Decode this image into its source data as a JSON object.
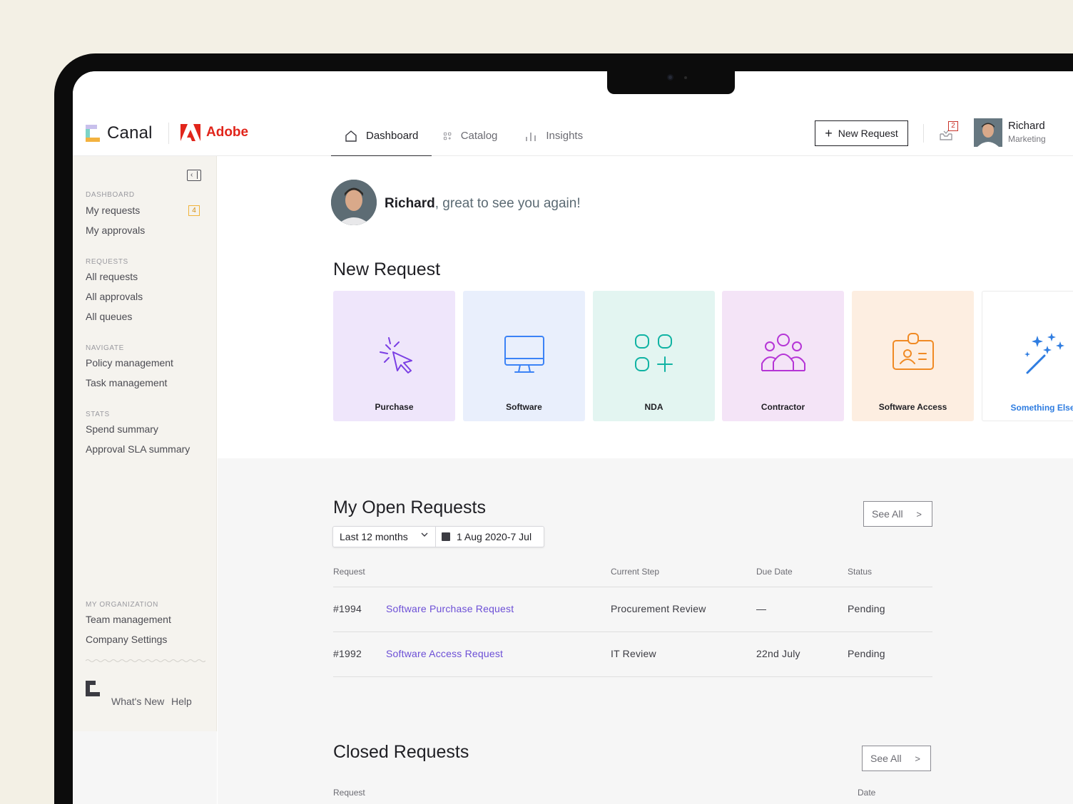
{
  "brand": {
    "app_name": "Canal",
    "partner_name": "Adobe"
  },
  "nav": {
    "items": [
      {
        "label": "Dashboard",
        "icon": "home-icon",
        "active": true
      },
      {
        "label": "Catalog",
        "icon": "grid-icon",
        "active": false
      },
      {
        "label": "Insights",
        "icon": "bar-chart-icon",
        "active": false
      }
    ]
  },
  "header": {
    "new_request_label": "New Request",
    "inbox_count": "2",
    "user": {
      "name": "Richard",
      "role": "Marketing"
    }
  },
  "sidebar": {
    "sections": [
      {
        "title": "DASHBOARD",
        "items": [
          "My requests",
          "My approvals"
        ]
      },
      {
        "title": "REQUESTS",
        "items": [
          "All requests",
          "All approvals",
          "All queues"
        ]
      },
      {
        "title": "NAVIGATE",
        "items": [
          "Policy management",
          "Task management"
        ]
      },
      {
        "title": "STATS",
        "items": [
          "Spend summary",
          "Approval SLA summary"
        ]
      },
      {
        "title": "MY ORGANIZATION",
        "items": [
          "Team management",
          "Company Settings"
        ]
      }
    ],
    "my_requests_badge": "4",
    "footer": {
      "whats_new": "What's New",
      "help": "Help"
    }
  },
  "greeting": {
    "name": "Richard",
    "message": ", great to see you again!"
  },
  "new_request": {
    "title": "New Request",
    "tiles": [
      {
        "label": "Purchase",
        "icon": "cursor-click-icon",
        "bg": "#efe6fb",
        "color": "#7b3fe4"
      },
      {
        "label": "Software",
        "icon": "monitor-icon",
        "bg": "#e9effc",
        "color": "#3b82f6"
      },
      {
        "label": "NDA",
        "icon": "apps-icon",
        "bg": "#e3f5f1",
        "color": "#10b3a3"
      },
      {
        "label": "Contractor",
        "icon": "team-icon",
        "bg": "#f4e4f7",
        "color": "#b535d6"
      },
      {
        "label": "Software Access",
        "icon": "id-badge-icon",
        "bg": "#fdeee1",
        "color": "#f08a24"
      },
      {
        "label": "Something Else",
        "icon": "magic-wand-icon",
        "bg": "#ffffff",
        "color": "#2f7de1"
      }
    ]
  },
  "open_requests": {
    "title": "My Open Requests",
    "see_all": "See All",
    "filter": {
      "range": "Last 12 months",
      "dates": "1 Aug 2020-7 Jul"
    },
    "columns": [
      "Request",
      "Current Step",
      "Due Date",
      "Status"
    ],
    "rows": [
      {
        "id": "#1994",
        "name": "Software Purchase Request",
        "step": "Procurement Review",
        "due": "—",
        "status": "Pending"
      },
      {
        "id": "#1992",
        "name": "Software Access Request",
        "step": "IT Review",
        "due": "22nd July",
        "status": "Pending"
      }
    ]
  },
  "closed_requests": {
    "title": "Closed Requests",
    "see_all": "See All",
    "columns": [
      "Request",
      "Date"
    ]
  }
}
